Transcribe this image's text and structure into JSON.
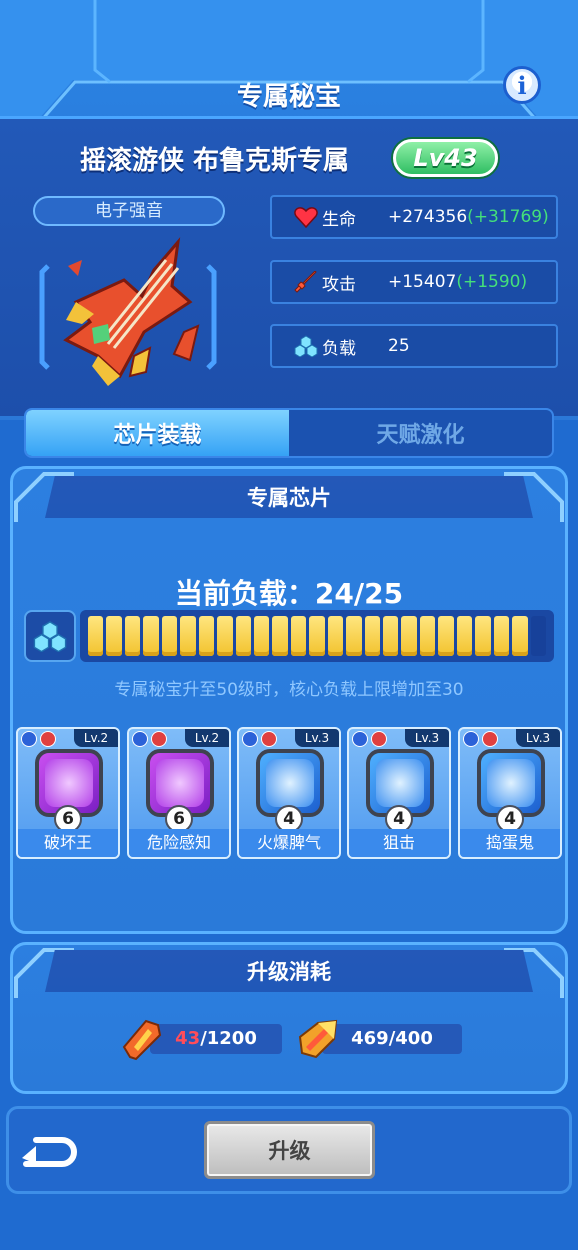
{
  "page": {
    "title": "专属秘宝",
    "info_label": "i"
  },
  "hero": {
    "name": "摇滚游侠 布鲁克斯专属",
    "level": "Lv43",
    "treasure_name": "电子强音"
  },
  "stats": [
    {
      "icon": "heart-icon",
      "label": "生命",
      "value": "+274356",
      "bonus": "(+31769)"
    },
    {
      "icon": "sword-icon",
      "label": "攻击",
      "value": "+15407",
      "bonus": "(+1590)"
    },
    {
      "icon": "load-cubes-icon",
      "label": "负载",
      "value": "25",
      "bonus": ""
    }
  ],
  "tabs": {
    "chip": "芯片装载",
    "talent": "天赋激化",
    "active": "chip"
  },
  "chip_section": {
    "title": "专属芯片",
    "load_label": "当前负载：24/25",
    "load_current": 24,
    "load_max": 25,
    "note": "专属秘宝升至50级时，核心负载上限增加至30",
    "chips": [
      {
        "name": "破坏王",
        "level": "Lv.2",
        "count": "6",
        "color": "purple",
        "icon": "vortex-icon"
      },
      {
        "name": "危险感知",
        "level": "Lv.2",
        "count": "6",
        "color": "purple",
        "icon": "shield-gem-icon"
      },
      {
        "name": "火爆脾气",
        "level": "Lv.3",
        "count": "4",
        "color": "blue",
        "icon": "meteor-icon"
      },
      {
        "name": "狙击",
        "level": "Lv.3",
        "count": "4",
        "color": "blue",
        "icon": "crosshair-icon"
      },
      {
        "name": "捣蛋鬼",
        "level": "Lv.3",
        "count": "4",
        "color": "blue",
        "icon": "diamond-burst-icon"
      }
    ]
  },
  "cost_section": {
    "title": "升级消耗",
    "items": [
      {
        "icon": "orange-crystal-icon",
        "have": "43",
        "need": "/1200"
      },
      {
        "icon": "gold-crystal-icon",
        "have": "469",
        "need": "/400"
      }
    ]
  },
  "footer": {
    "upgrade_label": "升级"
  },
  "colors": {
    "bonus_green": "#44e07a",
    "insufficient_red": "#ff4d5a",
    "load_fill": "#f7d448",
    "level_badge": "#2fbe63"
  }
}
